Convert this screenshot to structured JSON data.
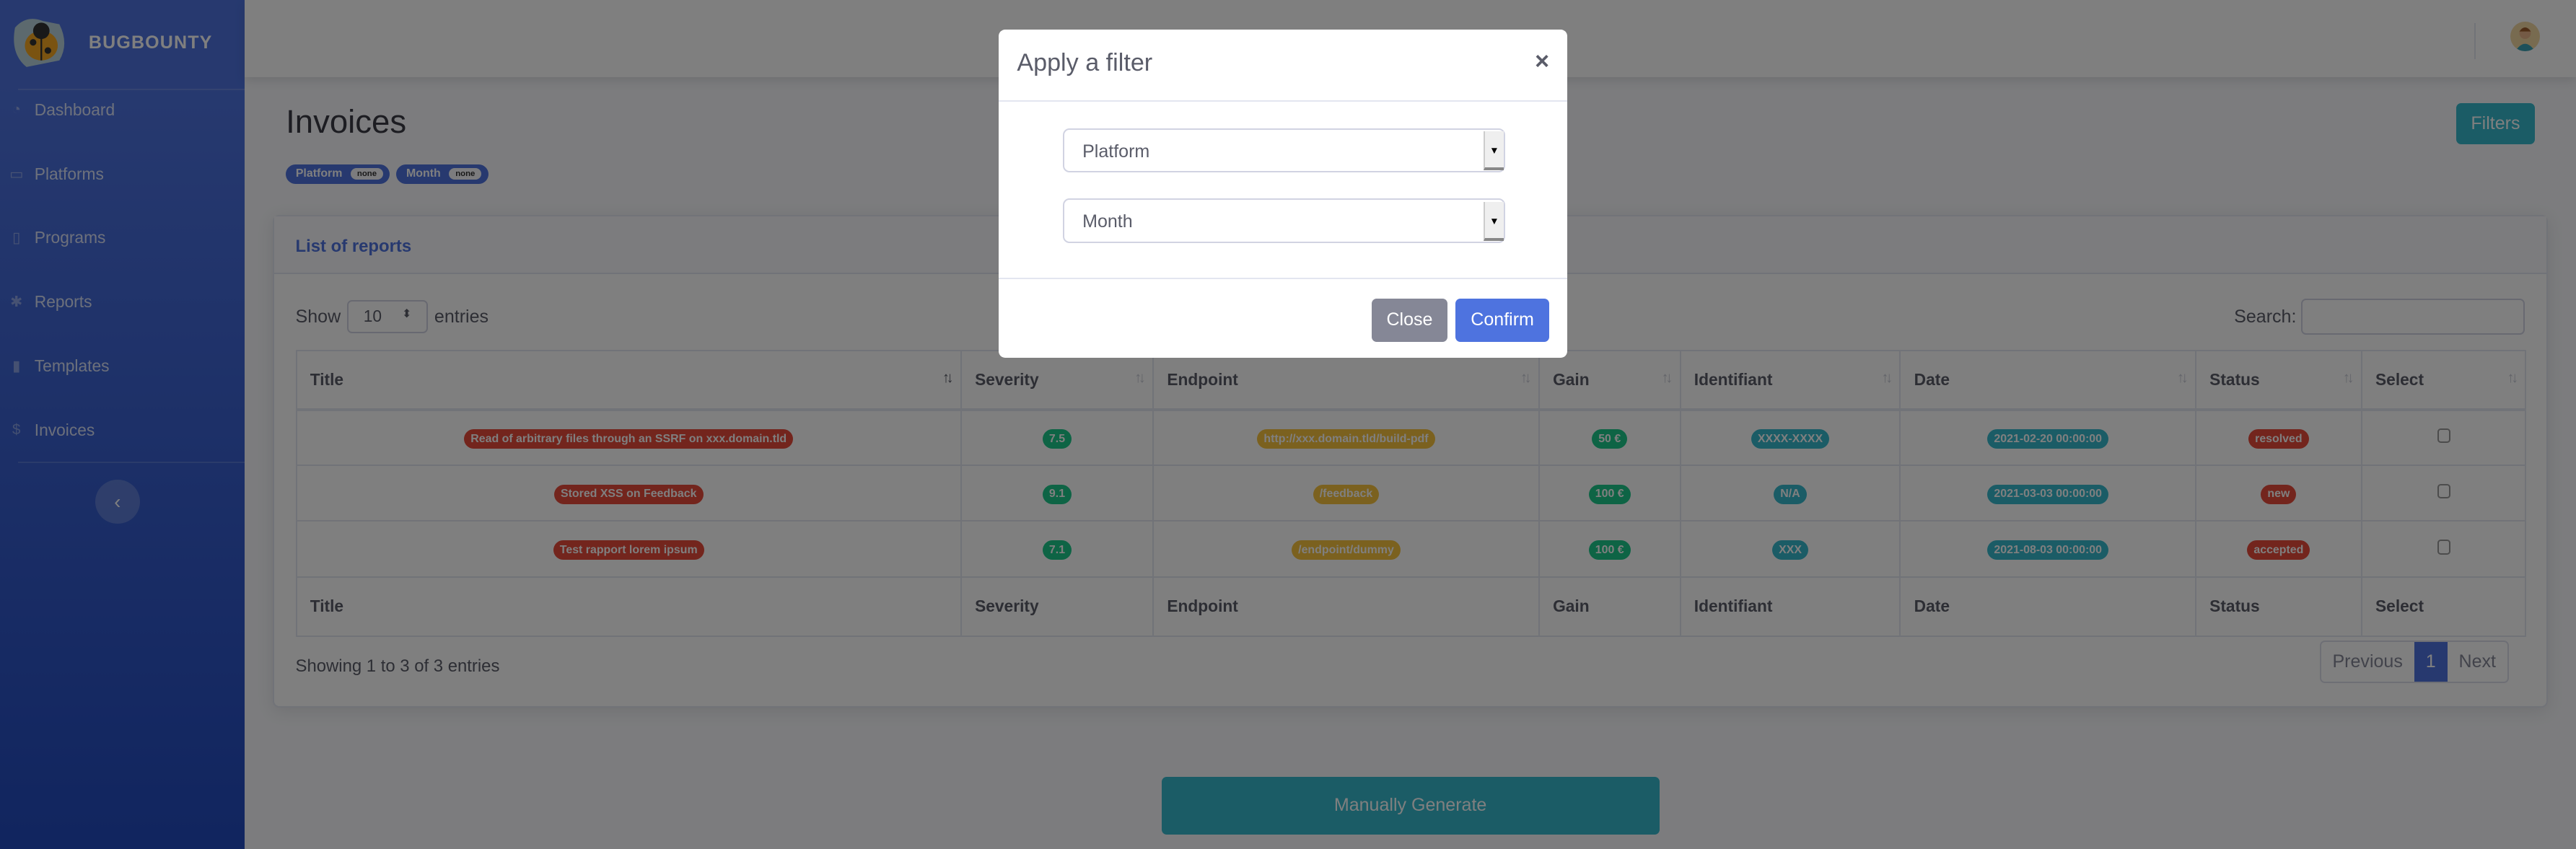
{
  "app": {
    "brand": "BUGBOUNTY"
  },
  "sidebar": {
    "items": [
      {
        "label": "Dashboard",
        "icon": "tachometer-icon"
      },
      {
        "label": "Platforms",
        "icon": "credit-card-icon"
      },
      {
        "label": "Programs",
        "icon": "file-icon"
      },
      {
        "label": "Reports",
        "icon": "bug-icon"
      },
      {
        "label": "Templates",
        "icon": "clipboard-icon"
      },
      {
        "label": "Invoices",
        "icon": "dollar-icon"
      }
    ],
    "toggle": "‹"
  },
  "page": {
    "title": "Invoices",
    "filters_button": "Filters",
    "active_filters": [
      {
        "name": "Platform",
        "value": "none"
      },
      {
        "name": "Month",
        "value": "none"
      }
    ]
  },
  "card": {
    "title": "List of reports",
    "show": "Show",
    "entries_value": "10",
    "entries": "entries",
    "search_label": "Search:",
    "columns": [
      "Title",
      "Severity",
      "Endpoint",
      "Gain",
      "Identifiant",
      "Date",
      "Status",
      "Select"
    ],
    "rows": [
      {
        "title": "Read of arbitrary files through an SSRF on xxx.domain.tld",
        "severity": "7.5",
        "endpoint": "http://xxx.domain.tld/build-pdf",
        "gain": "50 €",
        "id": "XXXX-XXXX",
        "date": "2021-02-20 00:00:00",
        "status": "resolved"
      },
      {
        "title": "Stored XSS on Feedback",
        "severity": "9.1",
        "endpoint": "/feedback",
        "gain": "100 €",
        "id": "N/A",
        "date": "2021-03-03 00:00:00",
        "status": "new"
      },
      {
        "title": "Test rapport lorem ipsum",
        "severity": "7.1",
        "endpoint": "/endpoint/dummy",
        "gain": "100 €",
        "id": "XXX",
        "date": "2021-08-03 00:00:00",
        "status": "accepted"
      }
    ],
    "info": "Showing 1 to 3 of 3 entries",
    "pagination": {
      "previous": "Previous",
      "current": "1",
      "next": "Next"
    }
  },
  "generate_button": "Manually Generate",
  "modal": {
    "title": "Apply a filter",
    "close_x": "×",
    "platform_select": "Platform",
    "month_select": "Month",
    "close": "Close",
    "confirm": "Confirm"
  },
  "colors": {
    "primary": "#4e73df",
    "info": "#36b9cc",
    "danger": "#e74a3b",
    "success": "#1cc88a",
    "warning": "#f6c23e",
    "secondary": "#858796"
  }
}
